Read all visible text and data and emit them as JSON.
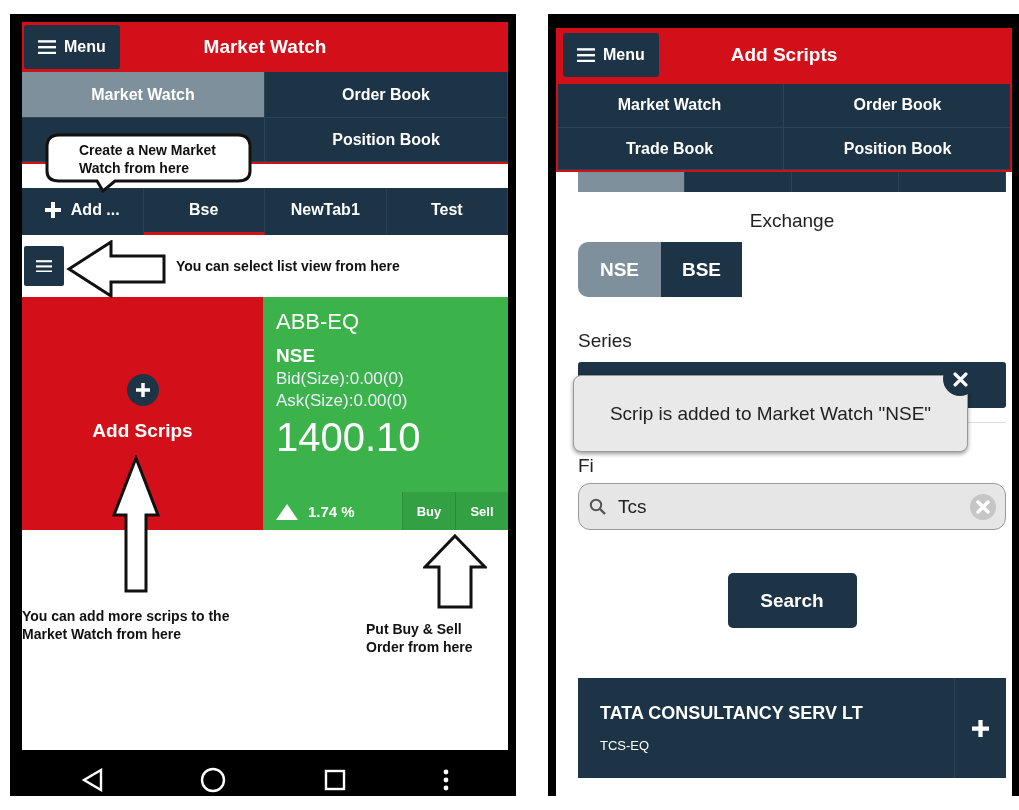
{
  "market_watch_screen": {
    "menu_label": "Menu",
    "title": "Market Watch",
    "nav": [
      {
        "label": "Market Watch",
        "selected": true
      },
      {
        "label": "Order Book",
        "selected": false
      },
      {
        "selected": false
      },
      {
        "label": "Position Book",
        "selected": false
      }
    ],
    "watch_tabs": [
      {
        "kind": "add",
        "label": "Add ...",
        "selected": false
      },
      {
        "kind": "tab",
        "label": "Bse",
        "selected": true
      },
      {
        "kind": "tab",
        "label": "NewTab1",
        "selected": false
      },
      {
        "kind": "tab",
        "label": "Test",
        "selected": false
      }
    ],
    "add_tile": {
      "label": "Add Scrips"
    },
    "quote": {
      "symbol": "ABB-EQ",
      "exchange": "NSE",
      "bid": "Bid(Size):0.00(0)",
      "ask": "Ask(Size):0.00(0)",
      "price": "1400.10",
      "rising": true,
      "change": "1.74 %",
      "actions": [
        "Buy",
        "Sell"
      ]
    },
    "annotations": [
      {
        "kind": "callout",
        "text": "Create a New Market Watch from here"
      },
      {
        "kind": "note",
        "text": "You can select list view from here"
      },
      {
        "kind": "note",
        "text": "You can add more scrips to the Market Watch from here"
      },
      {
        "kind": "note",
        "text": "Put Buy & Sell Order from here"
      }
    ]
  },
  "add_scripts_screen": {
    "menu_label": "Menu",
    "title": "Add Scripts",
    "nav": [
      {
        "label": "Market Watch",
        "selected": false
      },
      {
        "label": "Order Book",
        "selected": false
      },
      {
        "label": "Trade Book",
        "selected": false
      },
      {
        "label": "Position Book",
        "selected": false
      }
    ],
    "segments": [
      {
        "selected": true
      },
      {
        "selected": false
      },
      {
        "selected": false
      },
      {
        "selected": false
      }
    ],
    "exchange_label": "Exchange",
    "exchanges": [
      {
        "label": "NSE",
        "selected": true
      },
      {
        "label": "BSE",
        "selected": false
      }
    ],
    "series_label": "Series",
    "toast": {
      "text": "Scrip is added to Market Watch \"NSE\""
    },
    "find_label": "Fi",
    "search": {
      "value": "Tcs"
    },
    "search_button": "Search",
    "results": [
      {
        "name": "TATA CONSULTANCY SERV LT",
        "symbol": "TCS-EQ"
      }
    ]
  }
}
